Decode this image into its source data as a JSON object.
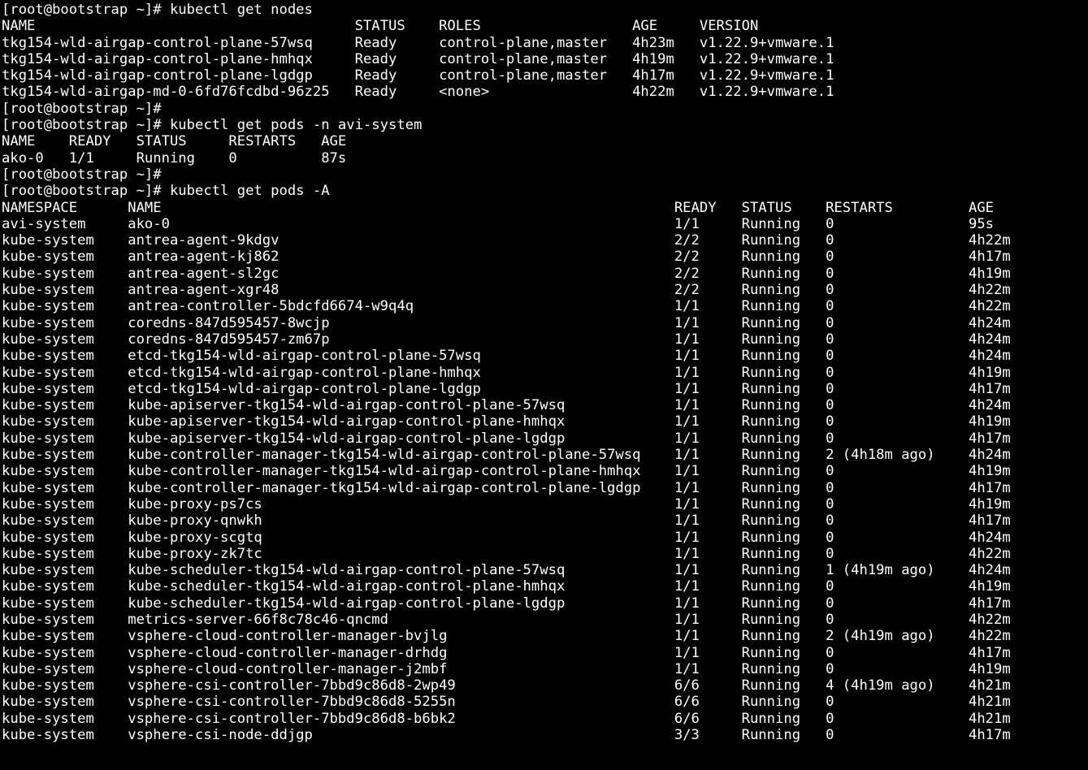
{
  "prompt": "[root@bootstrap ~]#",
  "cmd1": "kubectl get nodes",
  "cmd2": "kubectl get pods -n avi-system",
  "cmd3": "kubectl get pods -A",
  "nodes": {
    "headers": [
      "NAME",
      "STATUS",
      "ROLES",
      "AGE",
      "VERSION"
    ],
    "rows": [
      {
        "name": "tkg154-wld-airgap-control-plane-57wsq",
        "status": "Ready",
        "roles": "control-plane,master",
        "age": "4h23m",
        "version": "v1.22.9+vmware.1"
      },
      {
        "name": "tkg154-wld-airgap-control-plane-hmhqx",
        "status": "Ready",
        "roles": "control-plane,master",
        "age": "4h19m",
        "version": "v1.22.9+vmware.1"
      },
      {
        "name": "tkg154-wld-airgap-control-plane-lgdgp",
        "status": "Ready",
        "roles": "control-plane,master",
        "age": "4h17m",
        "version": "v1.22.9+vmware.1"
      },
      {
        "name": "tkg154-wld-airgap-md-0-6fd76fcdbd-96z25",
        "status": "Ready",
        "roles": "<none>",
        "age": "4h22m",
        "version": "v1.22.9+vmware.1"
      }
    ]
  },
  "avi": {
    "headers": [
      "NAME",
      "READY",
      "STATUS",
      "RESTARTS",
      "AGE"
    ],
    "rows": [
      {
        "name": "ako-0",
        "ready": "1/1",
        "status": "Running",
        "restarts": "0",
        "age": "87s"
      }
    ]
  },
  "all": {
    "headers": [
      "NAMESPACE",
      "NAME",
      "READY",
      "STATUS",
      "RESTARTS",
      "AGE"
    ],
    "rows": [
      {
        "ns": "avi-system",
        "name": "ako-0",
        "ready": "1/1",
        "status": "Running",
        "restarts": "0",
        "age": "95s"
      },
      {
        "ns": "kube-system",
        "name": "antrea-agent-9kdgv",
        "ready": "2/2",
        "status": "Running",
        "restarts": "0",
        "age": "4h22m"
      },
      {
        "ns": "kube-system",
        "name": "antrea-agent-kj862",
        "ready": "2/2",
        "status": "Running",
        "restarts": "0",
        "age": "4h17m"
      },
      {
        "ns": "kube-system",
        "name": "antrea-agent-sl2gc",
        "ready": "2/2",
        "status": "Running",
        "restarts": "0",
        "age": "4h19m"
      },
      {
        "ns": "kube-system",
        "name": "antrea-agent-xgr48",
        "ready": "2/2",
        "status": "Running",
        "restarts": "0",
        "age": "4h22m"
      },
      {
        "ns": "kube-system",
        "name": "antrea-controller-5bdcfd6674-w9q4q",
        "ready": "1/1",
        "status": "Running",
        "restarts": "0",
        "age": "4h22m"
      },
      {
        "ns": "kube-system",
        "name": "coredns-847d595457-8wcjp",
        "ready": "1/1",
        "status": "Running",
        "restarts": "0",
        "age": "4h24m"
      },
      {
        "ns": "kube-system",
        "name": "coredns-847d595457-zm67p",
        "ready": "1/1",
        "status": "Running",
        "restarts": "0",
        "age": "4h24m"
      },
      {
        "ns": "kube-system",
        "name": "etcd-tkg154-wld-airgap-control-plane-57wsq",
        "ready": "1/1",
        "status": "Running",
        "restarts": "0",
        "age": "4h24m"
      },
      {
        "ns": "kube-system",
        "name": "etcd-tkg154-wld-airgap-control-plane-hmhqx",
        "ready": "1/1",
        "status": "Running",
        "restarts": "0",
        "age": "4h19m"
      },
      {
        "ns": "kube-system",
        "name": "etcd-tkg154-wld-airgap-control-plane-lgdgp",
        "ready": "1/1",
        "status": "Running",
        "restarts": "0",
        "age": "4h17m"
      },
      {
        "ns": "kube-system",
        "name": "kube-apiserver-tkg154-wld-airgap-control-plane-57wsq",
        "ready": "1/1",
        "status": "Running",
        "restarts": "0",
        "age": "4h24m"
      },
      {
        "ns": "kube-system",
        "name": "kube-apiserver-tkg154-wld-airgap-control-plane-hmhqx",
        "ready": "1/1",
        "status": "Running",
        "restarts": "0",
        "age": "4h19m"
      },
      {
        "ns": "kube-system",
        "name": "kube-apiserver-tkg154-wld-airgap-control-plane-lgdgp",
        "ready": "1/1",
        "status": "Running",
        "restarts": "0",
        "age": "4h17m"
      },
      {
        "ns": "kube-system",
        "name": "kube-controller-manager-tkg154-wld-airgap-control-plane-57wsq",
        "ready": "1/1",
        "status": "Running",
        "restarts": "2 (4h18m ago)",
        "age": "4h24m"
      },
      {
        "ns": "kube-system",
        "name": "kube-controller-manager-tkg154-wld-airgap-control-plane-hmhqx",
        "ready": "1/1",
        "status": "Running",
        "restarts": "0",
        "age": "4h19m"
      },
      {
        "ns": "kube-system",
        "name": "kube-controller-manager-tkg154-wld-airgap-control-plane-lgdgp",
        "ready": "1/1",
        "status": "Running",
        "restarts": "0",
        "age": "4h17m"
      },
      {
        "ns": "kube-system",
        "name": "kube-proxy-ps7cs",
        "ready": "1/1",
        "status": "Running",
        "restarts": "0",
        "age": "4h19m"
      },
      {
        "ns": "kube-system",
        "name": "kube-proxy-qnwkh",
        "ready": "1/1",
        "status": "Running",
        "restarts": "0",
        "age": "4h17m"
      },
      {
        "ns": "kube-system",
        "name": "kube-proxy-scgtq",
        "ready": "1/1",
        "status": "Running",
        "restarts": "0",
        "age": "4h24m"
      },
      {
        "ns": "kube-system",
        "name": "kube-proxy-zk7tc",
        "ready": "1/1",
        "status": "Running",
        "restarts": "0",
        "age": "4h22m"
      },
      {
        "ns": "kube-system",
        "name": "kube-scheduler-tkg154-wld-airgap-control-plane-57wsq",
        "ready": "1/1",
        "status": "Running",
        "restarts": "1 (4h19m ago)",
        "age": "4h24m"
      },
      {
        "ns": "kube-system",
        "name": "kube-scheduler-tkg154-wld-airgap-control-plane-hmhqx",
        "ready": "1/1",
        "status": "Running",
        "restarts": "0",
        "age": "4h19m"
      },
      {
        "ns": "kube-system",
        "name": "kube-scheduler-tkg154-wld-airgap-control-plane-lgdgp",
        "ready": "1/1",
        "status": "Running",
        "restarts": "0",
        "age": "4h17m"
      },
      {
        "ns": "kube-system",
        "name": "metrics-server-66f8c78c46-qncmd",
        "ready": "1/1",
        "status": "Running",
        "restarts": "0",
        "age": "4h22m"
      },
      {
        "ns": "kube-system",
        "name": "vsphere-cloud-controller-manager-bvjlg",
        "ready": "1/1",
        "status": "Running",
        "restarts": "2 (4h19m ago)",
        "age": "4h22m"
      },
      {
        "ns": "kube-system",
        "name": "vsphere-cloud-controller-manager-drhdg",
        "ready": "1/1",
        "status": "Running",
        "restarts": "0",
        "age": "4h17m"
      },
      {
        "ns": "kube-system",
        "name": "vsphere-cloud-controller-manager-j2mbf",
        "ready": "1/1",
        "status": "Running",
        "restarts": "0",
        "age": "4h19m"
      },
      {
        "ns": "kube-system",
        "name": "vsphere-csi-controller-7bbd9c86d8-2wp49",
        "ready": "6/6",
        "status": "Running",
        "restarts": "4 (4h19m ago)",
        "age": "4h21m"
      },
      {
        "ns": "kube-system",
        "name": "vsphere-csi-controller-7bbd9c86d8-5255n",
        "ready": "6/6",
        "status": "Running",
        "restarts": "0",
        "age": "4h21m"
      },
      {
        "ns": "kube-system",
        "name": "vsphere-csi-controller-7bbd9c86d8-b6bk2",
        "ready": "6/6",
        "status": "Running",
        "restarts": "0",
        "age": "4h21m"
      },
      {
        "ns": "kube-system",
        "name": "vsphere-csi-node-ddjgp",
        "ready": "3/3",
        "status": "Running",
        "restarts": "0",
        "age": "4h17m"
      }
    ]
  }
}
